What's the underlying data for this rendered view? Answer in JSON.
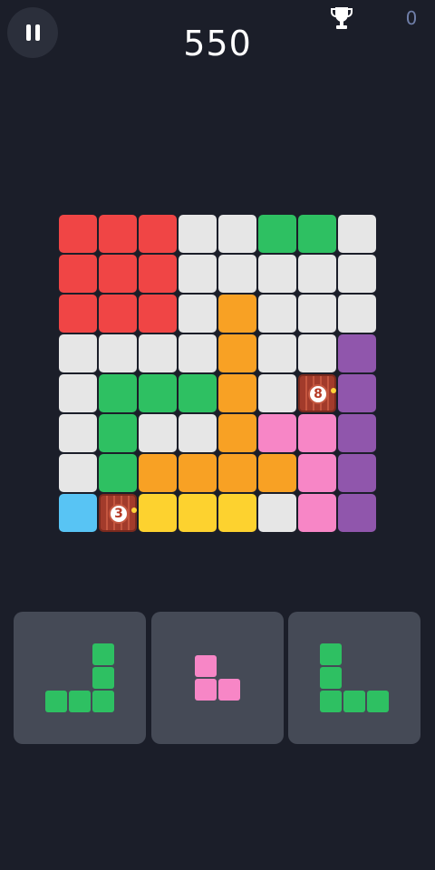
{
  "header": {
    "score": "550",
    "best_score": "0",
    "pause_icon": "pause-icon",
    "trophy_icon": "trophy-icon"
  },
  "colors": {
    "background": "#1b1e29",
    "empty": "#e6e6e6",
    "red": "#f04545",
    "green": "#2ec062",
    "orange": "#f8a124",
    "purple": "#9056ac",
    "pink": "#f786c6",
    "blue": "#58c4f4",
    "yellow": "#fdd22f"
  },
  "board": {
    "rows": 8,
    "cols": 8,
    "cells": [
      [
        "red",
        "red",
        "red",
        "empty",
        "empty",
        "green",
        "green",
        "empty"
      ],
      [
        "red",
        "red",
        "red",
        "empty",
        "empty",
        "empty",
        "empty",
        "empty"
      ],
      [
        "red",
        "red",
        "red",
        "empty",
        "orange",
        "empty",
        "empty",
        "empty"
      ],
      [
        "empty",
        "empty",
        "empty",
        "empty",
        "orange",
        "empty",
        "empty",
        "purple"
      ],
      [
        "empty",
        "green",
        "green",
        "green",
        "orange",
        "empty",
        "bomb",
        "purple"
      ],
      [
        "empty",
        "green",
        "empty",
        "empty",
        "orange",
        "pink",
        "pink",
        "purple"
      ],
      [
        "empty",
        "green",
        "orange",
        "orange",
        "orange",
        "orange",
        "pink",
        "purple"
      ],
      [
        "blue",
        "bomb",
        "yellow",
        "yellow",
        "yellow",
        "empty",
        "pink",
        "purple"
      ]
    ],
    "bombs": [
      {
        "row": 4,
        "col": 6,
        "count": "8"
      },
      {
        "row": 7,
        "col": 1,
        "count": "3"
      }
    ]
  },
  "pieces": [
    {
      "color": "green",
      "cells": [
        [
          0,
          2
        ],
        [
          1,
          2
        ],
        [
          2,
          0
        ],
        [
          2,
          1
        ],
        [
          2,
          2
        ]
      ]
    },
    {
      "color": "pink",
      "cells": [
        [
          0,
          0
        ],
        [
          1,
          0
        ],
        [
          1,
          1
        ]
      ]
    },
    {
      "color": "green",
      "cells": [
        [
          0,
          0
        ],
        [
          1,
          0
        ],
        [
          2,
          0
        ],
        [
          2,
          1
        ],
        [
          2,
          2
        ]
      ]
    }
  ]
}
